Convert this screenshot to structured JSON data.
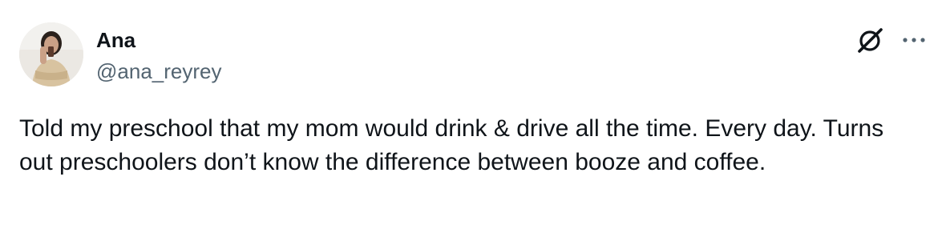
{
  "tweet": {
    "author": {
      "name": "Ana",
      "handle": "@ana_reyrey",
      "avatar": "profile-photo"
    },
    "text": "Told my preschool that my mom would drink & drive all the time. Every day. Turns out preschoolers don’t know the difference between booze and coffee.",
    "icons": {
      "grok": "grok-icon",
      "more": "more-options-icon"
    }
  },
  "colors": {
    "text_primary": "#0f1419",
    "text_secondary": "#536471",
    "background": "#ffffff"
  }
}
